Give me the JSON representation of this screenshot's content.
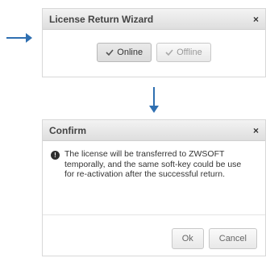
{
  "wizard": {
    "title": "License Return Wizard",
    "close_label": "×",
    "online_label": "Online",
    "offline_label": "Offline"
  },
  "confirm": {
    "title": "Confirm",
    "close_label": "×",
    "info_glyph": "!",
    "message": "The license will be transferred to ZWSOFT temporally, and the same soft-key could be use for re-activation after the successful return.",
    "ok_label": "Ok",
    "cancel_label": "Cancel"
  },
  "colors": {
    "arrow": "#2f6fb1",
    "titlebar": "#e6e6e6"
  },
  "icons": [
    "arrow-right-icon",
    "arrow-down-icon",
    "close-icon",
    "check-icon",
    "info-icon"
  ]
}
